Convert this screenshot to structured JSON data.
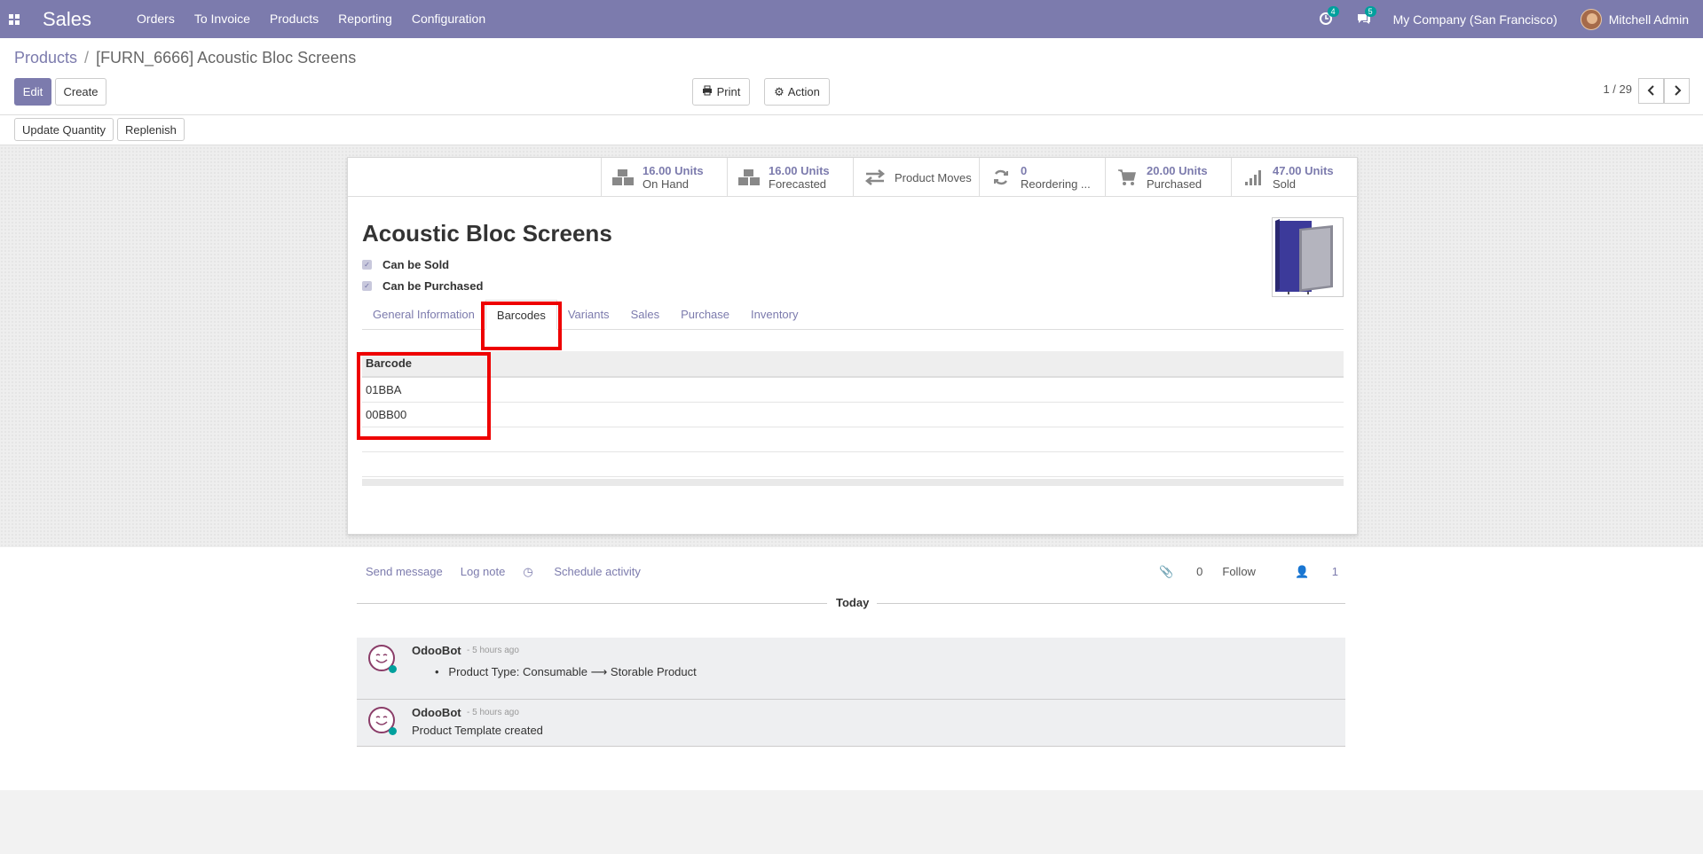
{
  "navbar": {
    "app_name": "Sales",
    "menu": [
      "Orders",
      "To Invoice",
      "Products",
      "Reporting",
      "Configuration"
    ],
    "activity_count": "4",
    "message_count": "5",
    "company": "My Company (San Francisco)",
    "user": "Mitchell Admin"
  },
  "breadcrumb": {
    "parent": "Products",
    "current": "[FURN_6666] Acoustic Bloc Screens"
  },
  "toolbar": {
    "edit": "Edit",
    "create": "Create",
    "print": "Print",
    "action": "Action",
    "pager": "1 / 29",
    "update_quantity": "Update Quantity",
    "replenish": "Replenish"
  },
  "smart_buttons": [
    {
      "value": "16.00 Units",
      "label": "On Hand",
      "icon": "cubes-icon"
    },
    {
      "value": "16.00 Units",
      "label": "Forecasted",
      "icon": "cubes-icon"
    },
    {
      "value": "",
      "label": "Product Moves",
      "icon": "exchange-icon"
    },
    {
      "value": "0",
      "label": "Reordering ...",
      "icon": "refresh-icon"
    },
    {
      "value": "20.00 Units",
      "label": "Purchased",
      "icon": "cart-icon"
    },
    {
      "value": "47.00 Units",
      "label": "Sold",
      "icon": "signal-icon"
    }
  ],
  "product": {
    "name": "Acoustic Bloc Screens",
    "can_be_sold": "Can be Sold",
    "can_be_purchased": "Can be Purchased"
  },
  "tabs": [
    "General Information",
    "Barcodes",
    "Variants",
    "Sales",
    "Purchase",
    "Inventory"
  ],
  "active_tab": "Barcodes",
  "barcodes": {
    "header": "Barcode",
    "rows": [
      "01BBA",
      "00BB00"
    ]
  },
  "chatter": {
    "send_message": "Send message",
    "log_note": "Log note",
    "schedule_activity": "Schedule activity",
    "attachments": "0",
    "follow": "Follow",
    "followers": "1",
    "today": "Today",
    "messages": [
      {
        "author": "OdooBot",
        "time": "- 5 hours ago",
        "field": "Product Type:",
        "old": "Consumable",
        "new": "Storable Product"
      },
      {
        "author": "OdooBot",
        "time": "- 5 hours ago",
        "body": "Product Template created"
      }
    ]
  },
  "colors": {
    "brand": "#7c7bad",
    "highlight": "#ee0000",
    "badge": "#00a09d"
  }
}
